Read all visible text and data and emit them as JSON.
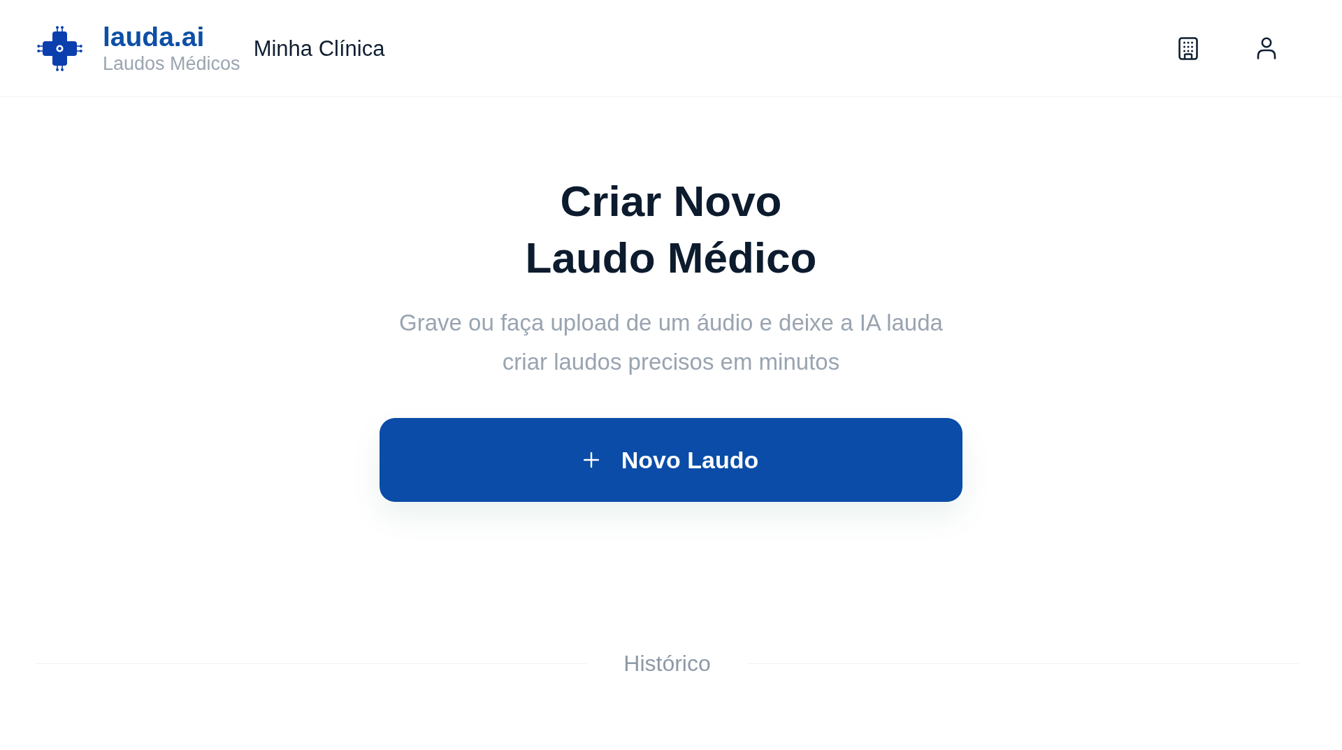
{
  "header": {
    "brand": {
      "name": "lauda.ai",
      "tagline": "Laudos Médicos"
    },
    "clinic": "Minha Clínica"
  },
  "hero": {
    "title_lines": [
      "Criar Novo",
      "Laudo Médico"
    ],
    "subtitle_lines": [
      "Grave ou faça upload de um áudio e deixe a IA lauda",
      "criar laudos precisos em minutos"
    ],
    "button": {
      "label": "Novo Laudo"
    }
  },
  "history": {
    "label": "Histórico"
  }
}
